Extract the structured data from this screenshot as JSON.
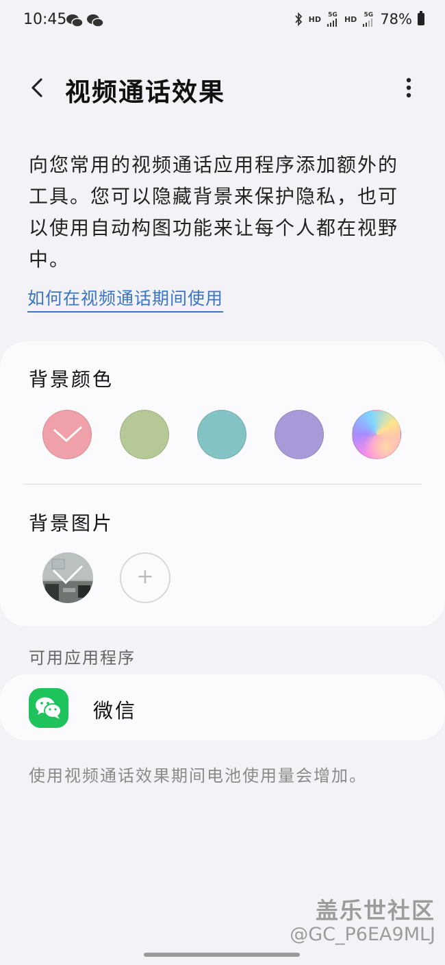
{
  "status_bar": {
    "time": "10:45",
    "notifications": [
      "wechat-icon",
      "wechat-icon"
    ],
    "hd1": "HD",
    "net1": "5G",
    "hd2": "HD",
    "net2": "5G",
    "battery": "78%"
  },
  "header": {
    "title": "视频通话效果",
    "back_icon": "chevron-left-icon",
    "more_icon": "more-vertical-icon"
  },
  "description": "向您常用的视频通话应用程序添加额外的工具。您可以隐藏背景来保护隐私，也可以使用自动构图功能来让每个人都在视野中。",
  "help_link": "如何在视频通话期间使用",
  "background_color": {
    "title": "背景颜色",
    "swatches": [
      {
        "color": "#f0a0a8",
        "selected": true
      },
      {
        "color": "#b5c895",
        "selected": false
      },
      {
        "color": "#84c3c4",
        "selected": false
      },
      {
        "color": "#a89ad8",
        "selected": false
      },
      {
        "color": "gradient",
        "selected": false
      }
    ]
  },
  "background_image": {
    "title": "背景图片",
    "photo_selected": true,
    "add_label": "+"
  },
  "apps_section": {
    "header": "可用应用程序",
    "apps": [
      {
        "name": "微信",
        "icon": "wechat-icon",
        "color": "#1fc35b"
      }
    ]
  },
  "footer_note": "使用视频通话效果期间电池使用量会增加。",
  "watermark": {
    "brand": "盖乐世社区",
    "user": "@GC_P6EA9MLJ"
  }
}
